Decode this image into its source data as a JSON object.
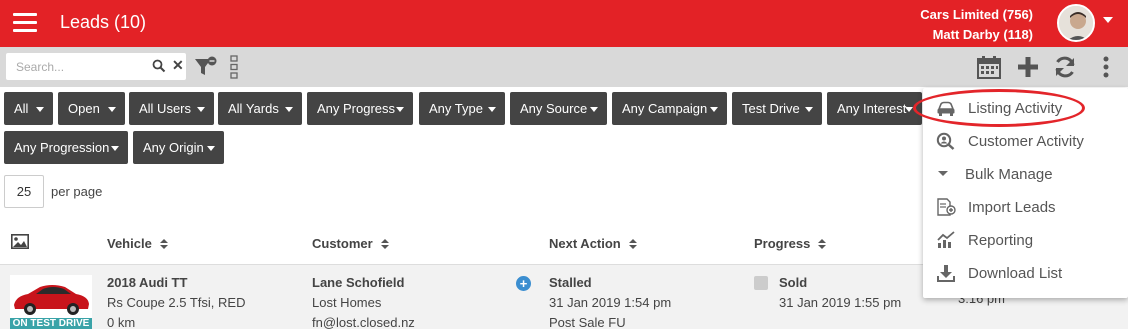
{
  "header": {
    "title": "Leads (10)",
    "company": "Cars Limited (756)",
    "user": "Matt Darby (118)"
  },
  "toolbar": {
    "search_placeholder": "Search...",
    "search_value": ""
  },
  "filters": [
    {
      "label": "All"
    },
    {
      "label": "Open"
    },
    {
      "label": "All Users"
    },
    {
      "label": "All Yards"
    },
    {
      "label": "Any Progress"
    },
    {
      "label": "Any Type"
    },
    {
      "label": "Any Source"
    },
    {
      "label": "Any Campaign"
    },
    {
      "label": "Test Drive"
    },
    {
      "label": "Any Interest"
    },
    {
      "label": "Any Progression"
    },
    {
      "label": "Any Origin"
    }
  ],
  "pagination": {
    "per_page": "25",
    "per_page_label": "per page"
  },
  "table": {
    "columns": [
      "Vehicle",
      "Customer",
      "Next Action",
      "Progress"
    ],
    "rows": [
      {
        "badge": "ON TEST DRIVE",
        "vehicle_name": "2018 Audi TT",
        "vehicle_detail": "Rs Coupe 2.5 Tfsi, RED",
        "vehicle_km": "0 km",
        "customer_name": "Lane Schofield",
        "customer_company": "Lost Homes",
        "customer_email": "fn@lost.closed.nz",
        "next_action": "Stalled",
        "next_action_date": "31 Jan 2019 1:54 pm",
        "next_action_note": "Post Sale FU",
        "progress": "Sold",
        "progress_date": "31 Jan 2019 1:55 pm",
        "extra_time": "3:16 pm"
      }
    ]
  },
  "menu": {
    "items": [
      {
        "label": "Listing Activity",
        "icon": "car-icon"
      },
      {
        "label": "Customer Activity",
        "icon": "user-search-icon"
      },
      {
        "label": "Bulk Manage",
        "icon": "caret-down-icon"
      },
      {
        "label": "Import Leads",
        "icon": "import-icon"
      },
      {
        "label": "Reporting",
        "icon": "chart-icon"
      },
      {
        "label": "Download List",
        "icon": "download-icon"
      }
    ],
    "highlighted": "Listing Activity"
  },
  "colors": {
    "brand": "#e32226",
    "filter_bg": "#444444",
    "toolbar_bg": "#d9d9d9",
    "highlight": "#e3252a",
    "badge": "#3aa3a8"
  }
}
